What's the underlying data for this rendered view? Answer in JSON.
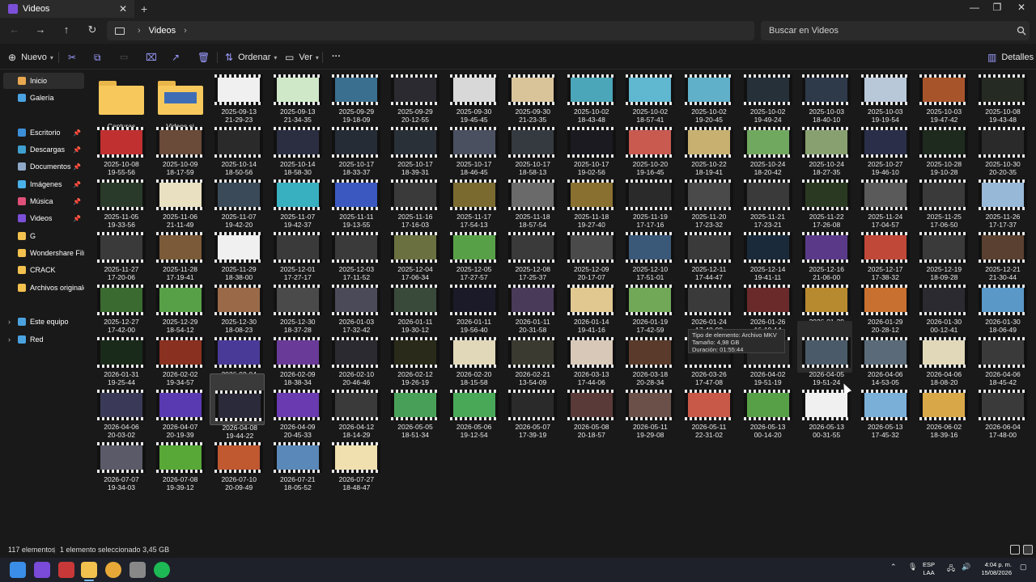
{
  "window": {
    "tab_title": "Videos",
    "tab_close": "✕",
    "new_tab": "+",
    "minimize": "—",
    "maximize": "❐",
    "close": "✕"
  },
  "nav": {
    "back": "←",
    "forward": "→",
    "up": "↑",
    "refresh": "↻"
  },
  "address": {
    "segments": [
      "Videos"
    ],
    "chevron": "›"
  },
  "search": {
    "placeholder": "Buscar en Videos",
    "icon": "search-icon"
  },
  "toolbar": {
    "nuevo": "Nuevo",
    "ordenar": "Ordenar",
    "ver": "Ver",
    "more": "···",
    "detalles": "Detalles"
  },
  "sidebar": {
    "items": [
      {
        "label": "Inicio",
        "icon": "home-icon",
        "color": "#e8a84f",
        "selected": true
      },
      {
        "label": "Galería",
        "icon": "gallery-icon",
        "color": "#4aa3e0"
      },
      {
        "label": "Escritorio",
        "icon": "desktop-icon",
        "color": "#3c8fd8",
        "pinned": true
      },
      {
        "label": "Descargas",
        "icon": "download-icon",
        "color": "#3fa0d0",
        "pinned": true
      },
      {
        "label": "Documentos",
        "icon": "documents-icon",
        "color": "#8fa8c8",
        "pinned": true
      },
      {
        "label": "Imágenes",
        "icon": "pictures-icon",
        "color": "#4ab0e8",
        "pinned": true
      },
      {
        "label": "Música",
        "icon": "music-icon",
        "color": "#e0507a",
        "pinned": true
      },
      {
        "label": "Videos",
        "icon": "videos-icon",
        "color": "#7b4fd8",
        "pinned": true
      },
      {
        "label": "G",
        "icon": "folder-icon",
        "color": "#f2c14e"
      },
      {
        "label": "Wondershare Filmora",
        "icon": "folder-icon",
        "color": "#f2c14e"
      },
      {
        "label": "CRACK",
        "icon": "folder-icon",
        "color": "#f2c14e"
      },
      {
        "label": "Archivos originales",
        "icon": "folder-icon",
        "color": "#f2c14e"
      },
      {
        "label": "Este equipo",
        "icon": "computer-icon",
        "color": "#4aa3e0",
        "expandable": true
      },
      {
        "label": "Red",
        "icon": "network-icon",
        "color": "#4aa3e0",
        "expandable": true
      }
    ]
  },
  "folders": [
    {
      "name": "Capturas"
    },
    {
      "name": "Videos si"
    }
  ],
  "videos": [
    {
      "d": "2025-09-13",
      "t": "21-29-23",
      "c": "#f0f0f0"
    },
    {
      "d": "2025-09-13",
      "t": "21-34-35",
      "c": "#cfe8c8"
    },
    {
      "d": "2025-09-29",
      "t": "19-18-09",
      "c": "#3b6f8f"
    },
    {
      "d": "2025-09-29",
      "t": "20-12-55",
      "c": "#2a2a30"
    },
    {
      "d": "2025-09-30",
      "t": "19-45-45",
      "c": "#d8d8d8"
    },
    {
      "d": "2025-09-30",
      "t": "21-23-35",
      "c": "#d9c49a"
    },
    {
      "d": "2025-10-02",
      "t": "18-43-48",
      "c": "#4aa6b8"
    },
    {
      "d": "2025-10-02",
      "t": "18-57-41",
      "c": "#5fb7d0"
    },
    {
      "d": "2025-10-02",
      "t": "19-20-45",
      "c": "#5fb0c8"
    },
    {
      "d": "2025-10-02",
      "t": "19-49-24",
      "c": "#253038"
    },
    {
      "d": "2025-10-03",
      "t": "18-40-10",
      "c": "#2e3a4a"
    },
    {
      "d": "2025-10-03",
      "t": "19-19-54",
      "c": "#b8c8d8"
    },
    {
      "d": "2025-10-03",
      "t": "19-47-42",
      "c": "#a8542a"
    },
    {
      "d": "2025-10-08",
      "t": "19-43-48",
      "c": "#252a22"
    },
    {
      "d": "2025-10-08",
      "t": "19-55-56",
      "c": "#c03030"
    },
    {
      "d": "2025-10-09",
      "t": "18-17-59",
      "c": "#6a4a38"
    },
    {
      "d": "2025-10-14",
      "t": "18-50-56",
      "c": "#2a2a2a"
    },
    {
      "d": "2025-10-14",
      "t": "18-58-30",
      "c": "#2a2e40"
    },
    {
      "d": "2025-10-17",
      "t": "18-33-37",
      "c": "#262c36"
    },
    {
      "d": "2025-10-17",
      "t": "18-39-31",
      "c": "#2a3038"
    },
    {
      "d": "2025-10-17",
      "t": "18-46-45",
      "c": "#4a5060"
    },
    {
      "d": "2025-10-17",
      "t": "18-58-13",
      "c": "#353a40"
    },
    {
      "d": "2025-10-17",
      "t": "19-02-56",
      "c": "#1a1a20"
    },
    {
      "d": "2025-10-20",
      "t": "19-16-45",
      "c": "#c85a50"
    },
    {
      "d": "2025-10-22",
      "t": "18-19-41",
      "c": "#c8b070"
    },
    {
      "d": "2025-10-24",
      "t": "18-20-42",
      "c": "#70a860"
    },
    {
      "d": "2025-10-24",
      "t": "18-27-35",
      "c": "#88a070"
    },
    {
      "d": "2025-10-27",
      "t": "19-46-10",
      "c": "#2a2e48"
    },
    {
      "d": "2025-10-28",
      "t": "19-10-28",
      "c": "#1e2a1e"
    },
    {
      "d": "2025-10-30",
      "t": "20-20-35",
      "c": "#2a2a2a"
    },
    {
      "d": "2025-11-05",
      "t": "19-33-56",
      "c": "#2a3a2a"
    },
    {
      "d": "2025-11-06",
      "t": "21-11-49",
      "c": "#e8e0c0"
    },
    {
      "d": "2025-11-07",
      "t": "19-42-20",
      "c": "#3a4a58"
    },
    {
      "d": "2025-11-07",
      "t": "19-42-37",
      "c": "#38b0c0"
    },
    {
      "d": "2025-11-11",
      "t": "19-13-55",
      "c": "#3a58c0"
    },
    {
      "d": "2025-11-16",
      "t": "17-16-03",
      "c": "#3a3a3a"
    },
    {
      "d": "2025-11-17",
      "t": "17-54-13",
      "c": "#7a6a30"
    },
    {
      "d": "2025-11-18",
      "t": "18-57-54",
      "c": "#6a6a6a"
    },
    {
      "d": "2025-11-18",
      "t": "19-27-40",
      "c": "#8a7030"
    },
    {
      "d": "2025-11-19",
      "t": "17-17-16",
      "c": "#2a2a2a"
    },
    {
      "d": "2025-11-20",
      "t": "17-23-32",
      "c": "#4a4a4a"
    },
    {
      "d": "2025-11-21",
      "t": "17-23-21",
      "c": "#3a3a3a"
    },
    {
      "d": "2025-11-22",
      "t": "17-26-08",
      "c": "#2a3a22"
    },
    {
      "d": "2025-11-24",
      "t": "17-04-57",
      "c": "#5a5a5a"
    },
    {
      "d": "2025-11-25",
      "t": "17-06-50",
      "c": "#3a3a3a"
    },
    {
      "d": "2025-11-26",
      "t": "17-17-37",
      "c": "#98b8d8"
    },
    {
      "d": "2025-11-27",
      "t": "17-20-06",
      "c": "#3a3a3a"
    },
    {
      "d": "2025-11-28",
      "t": "17-19-41",
      "c": "#7a5a38"
    },
    {
      "d": "2025-11-29",
      "t": "18-38-00",
      "c": "#f0f0f0"
    },
    {
      "d": "2025-12-01",
      "t": "17-27-17",
      "c": "#3a3a3a"
    },
    {
      "d": "2025-12-03",
      "t": "17-11-52",
      "c": "#3a3a3a"
    },
    {
      "d": "2025-12-04",
      "t": "17-06-34",
      "c": "#6a7040"
    },
    {
      "d": "2025-12-05",
      "t": "17-27-57",
      "c": "#58a048"
    },
    {
      "d": "2025-12-08",
      "t": "17-25-37",
      "c": "#3a3a3a"
    },
    {
      "d": "2025-12-09",
      "t": "20-17-07",
      "c": "#4a4a4a"
    },
    {
      "d": "2025-12-10",
      "t": "17-51-01",
      "c": "#3a5878"
    },
    {
      "d": "2025-12-11",
      "t": "17-44-47",
      "c": "#3a3a3a"
    },
    {
      "d": "2025-12-14",
      "t": "19-41-11",
      "c": "#1a2a3a"
    },
    {
      "d": "2025-12-16",
      "t": "21-06-00",
      "c": "#5a3a88"
    },
    {
      "d": "2025-12-17",
      "t": "17-38-32",
      "c": "#c04838"
    },
    {
      "d": "2025-12-19",
      "t": "18-09-28",
      "c": "#3a3a3a"
    },
    {
      "d": "2025-12-21",
      "t": "21-30-44",
      "c": "#5a4030"
    },
    {
      "d": "2025-12-27",
      "t": "17-42-00",
      "c": "#3a6a30"
    },
    {
      "d": "2025-12-29",
      "t": "18-54-12",
      "c": "#58a048"
    },
    {
      "d": "2025-12-30",
      "t": "18-08-23",
      "c": "#9a6a48"
    },
    {
      "d": "2025-12-30",
      "t": "18-37-28",
      "c": "#4a4a4a"
    },
    {
      "d": "2026-01-03",
      "t": "17-32-42",
      "c": "#4a4a58"
    },
    {
      "d": "2026-01-11",
      "t": "19-30-12",
      "c": "#3a4a3a"
    },
    {
      "d": "2026-01-11",
      "t": "19-56-40",
      "c": "#1a1a28"
    },
    {
      "d": "2026-01-11",
      "t": "20-31-58",
      "c": "#4a3a5a"
    },
    {
      "d": "2026-01-14",
      "t": "19-41-16",
      "c": "#e0c890"
    },
    {
      "d": "2026-01-19",
      "t": "17-42-59",
      "c": "#70a858"
    },
    {
      "d": "2026-01-24",
      "t": "17-48-08",
      "c": "#3a3a3a"
    },
    {
      "d": "2026-01-26",
      "t": "16-19-14",
      "c": "#6a2a2a"
    },
    {
      "d": "2026-01-29",
      "t": "19-39-08",
      "c": "#b88a30"
    },
    {
      "d": "2026-01-29",
      "t": "20-28-12",
      "c": "#c87030"
    },
    {
      "d": "2026-01-30",
      "t": "00-12-41",
      "c": "#2a2a30"
    },
    {
      "d": "2026-01-30",
      "t": "18-06-49",
      "c": "#5a98c8"
    },
    {
      "d": "2026-01-31",
      "t": "19-25-44",
      "c": "#1a2a1a"
    },
    {
      "d": "2026-02-02",
      "t": "19-34-57",
      "c": "#8a3020"
    },
    {
      "d": "2026-02-04",
      "t": "19-24-45",
      "c": "#4a3a98"
    },
    {
      "d": "2026-02-09",
      "t": "18-38-34",
      "c": "#6a3a98"
    },
    {
      "d": "2026-02-10",
      "t": "20-46-46",
      "c": "#2a2a30"
    },
    {
      "d": "2026-02-12",
      "t": "19-26-19",
      "c": "#2a2a1a"
    },
    {
      "d": "2026-02-20",
      "t": "18-15-58",
      "c": "#e0d8b8"
    },
    {
      "d": "2026-02-21",
      "t": "13-54-09",
      "c": "#3a3a30"
    },
    {
      "d": "2026-03-13",
      "t": "17-44-06",
      "c": "#d8c8b8"
    },
    {
      "d": "2026-03-18",
      "t": "20-28-34",
      "c": "#5a3a2a"
    },
    {
      "d": "2026-03-26",
      "t": "17-47-08",
      "c": "#1a1a1a"
    },
    {
      "d": "2026-04-02",
      "t": "19-51-19",
      "c": "#2a2a2a"
    },
    {
      "d": "2026-04-05",
      "t": "19-51-24",
      "c": "#4a5a68"
    },
    {
      "d": "2026-04-06",
      "t": "14-53-05",
      "c": "#5a6a78"
    },
    {
      "d": "2026-04-06",
      "t": "18-08-20",
      "c": "#e0d8b8"
    },
    {
      "d": "2026-04-06",
      "t": "18-45-42",
      "c": "#3a3a3a"
    },
    {
      "d": "2026-04-06",
      "t": "20-03-02",
      "c": "#3a3a58"
    },
    {
      "d": "2026-04-07",
      "t": "20-19-39",
      "c": "#5a3ab0"
    },
    {
      "d": "2026-04-08",
      "t": "19-44-22",
      "c": "#2a2a3a"
    },
    {
      "d": "2026-04-09",
      "t": "20-45-33",
      "c": "#6a3ab0"
    },
    {
      "d": "2026-04-12",
      "t": "18-14-29",
      "c": "#3a3a3a"
    },
    {
      "d": "2026-05-05",
      "t": "18-51-34",
      "c": "#48a058"
    },
    {
      "d": "2026-05-06",
      "t": "19-12-54",
      "c": "#48a858"
    },
    {
      "d": "2026-05-07",
      "t": "17-39-19",
      "c": "#2a2a2a"
    },
    {
      "d": "2026-05-08",
      "t": "20-18-57",
      "c": "#5a3a38"
    },
    {
      "d": "2026-05-11",
      "t": "19-29-08",
      "c": "#6a5048"
    },
    {
      "d": "2026-05-11",
      "t": "22-31-02",
      "c": "#c85848"
    },
    {
      "d": "2026-05-13",
      "t": "00-14-20",
      "c": "#58a048"
    },
    {
      "d": "2026-05-13",
      "t": "00-31-55",
      "c": "#f0f0f0"
    },
    {
      "d": "2026-05-13",
      "t": "17-45-32",
      "c": "#7ab0d8"
    },
    {
      "d": "2026-06-02",
      "t": "18-39-16",
      "c": "#d8a848"
    },
    {
      "d": "2026-06-04",
      "t": "17-48-00",
      "c": "#3a3a3a"
    },
    {
      "d": "2026-07-07",
      "t": "19-34-03",
      "c": "#5a5a68"
    },
    {
      "d": "2026-07-08",
      "t": "19-39-12",
      "c": "#58a838"
    },
    {
      "d": "2026-07-10",
      "t": "20-09-49",
      "c": "#c05830"
    },
    {
      "d": "2026-07-21",
      "t": "18-05-52",
      "c": "#5a88b8"
    },
    {
      "d": "2026-07-27",
      "t": "18-48-47",
      "c": "#f0e0b0"
    }
  ],
  "tooltip": {
    "line1": "Tipo de elemento: Archivo MKV",
    "line2": "Tamaño: 4,98 GB",
    "line3": "Duración: 01:55:44"
  },
  "status": {
    "count": "117 elementos",
    "selection": "1 elemento seleccionado  3,45 GB"
  },
  "taskbar": {
    "apps": [
      {
        "name": "windows-start-icon",
        "color": "#3a8ee8"
      },
      {
        "name": "app-icon",
        "color": "#7a4ad8"
      },
      {
        "name": "app-icon",
        "color": "#c83838"
      },
      {
        "name": "file-explorer-icon",
        "color": "#f2c14e"
      },
      {
        "name": "chrome-icon",
        "color": "#e8a838"
      },
      {
        "name": "app-icon",
        "color": "#888888"
      },
      {
        "name": "spotify-icon",
        "color": "#1db954"
      }
    ],
    "lang_top": "ESP",
    "lang_bottom": "LAA",
    "time": "4:04 p. m.",
    "date": "15/08/2026"
  }
}
